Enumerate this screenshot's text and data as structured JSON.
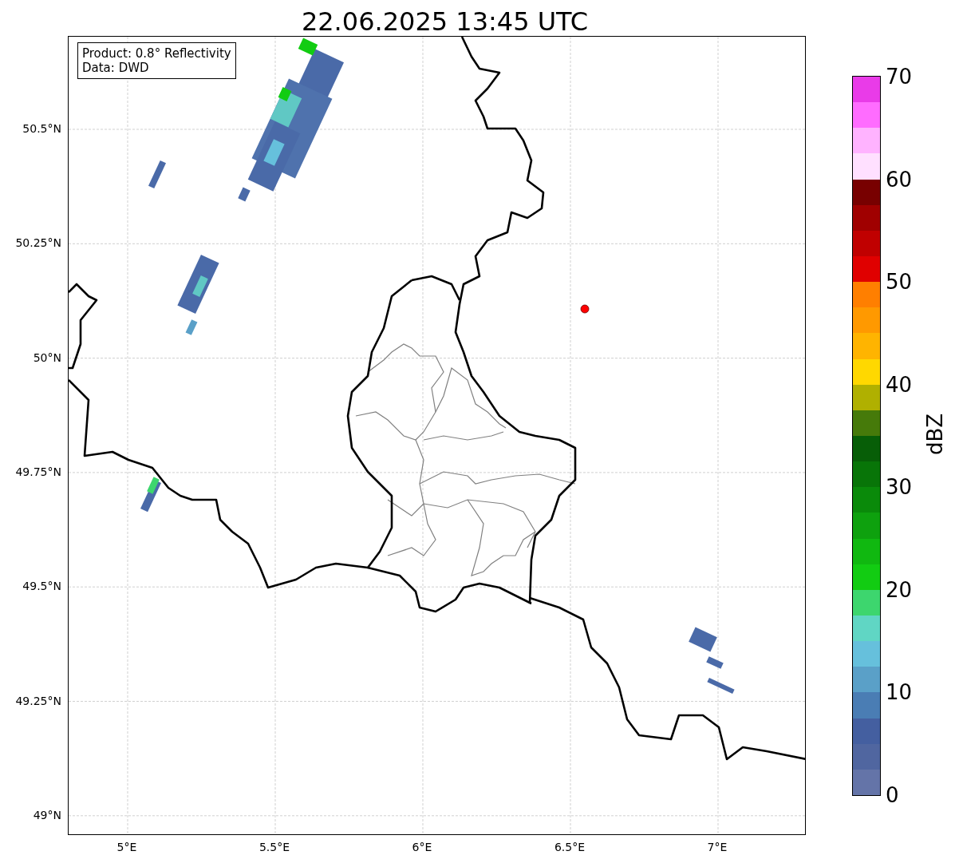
{
  "title": "22.06.2025 13:45 UTC",
  "legend": [
    "Product: 0.8° Reflectivity",
    "Data: DWD"
  ],
  "map": {
    "yticks": [
      "50.5°N",
      "50.25°N",
      "50°N",
      "49.75°N",
      "49.5°N",
      "49.25°N",
      "49°N"
    ],
    "xticks": [
      "5°E",
      "5.5°E",
      "6°E",
      "6.5°E",
      "7°E"
    ]
  },
  "colorbar": {
    "label": "dBZ",
    "ticks": [
      "70",
      "60",
      "50",
      "40",
      "30",
      "20",
      "10",
      "0"
    ],
    "segments": [
      {
        "color": "#e93be8"
      },
      {
        "color": "#ff6cff"
      },
      {
        "color": "#ffb3ff"
      },
      {
        "color": "#ffe0ff"
      },
      {
        "color": "#780000"
      },
      {
        "color": "#a00000"
      },
      {
        "color": "#c00000"
      },
      {
        "color": "#e00000"
      },
      {
        "color": "#ff7f00"
      },
      {
        "color": "#ff9900"
      },
      {
        "color": "#ffb400"
      },
      {
        "color": "#ffd800"
      },
      {
        "color": "#b0b000"
      },
      {
        "color": "#467a0a"
      },
      {
        "color": "#075e07"
      },
      {
        "color": "#087508"
      },
      {
        "color": "#0a8a0a"
      },
      {
        "color": "#0ea10e"
      },
      {
        "color": "#10b810"
      },
      {
        "color": "#12cc12"
      },
      {
        "color": "#3dd66e"
      },
      {
        "color": "#60d6c4"
      },
      {
        "color": "#66c0dc"
      },
      {
        "color": "#5aa0c8"
      },
      {
        "color": "#4a7db4"
      },
      {
        "color": "#445fa0"
      },
      {
        "color": "#5066a0"
      },
      {
        "color": "#6474a8"
      }
    ]
  }
}
